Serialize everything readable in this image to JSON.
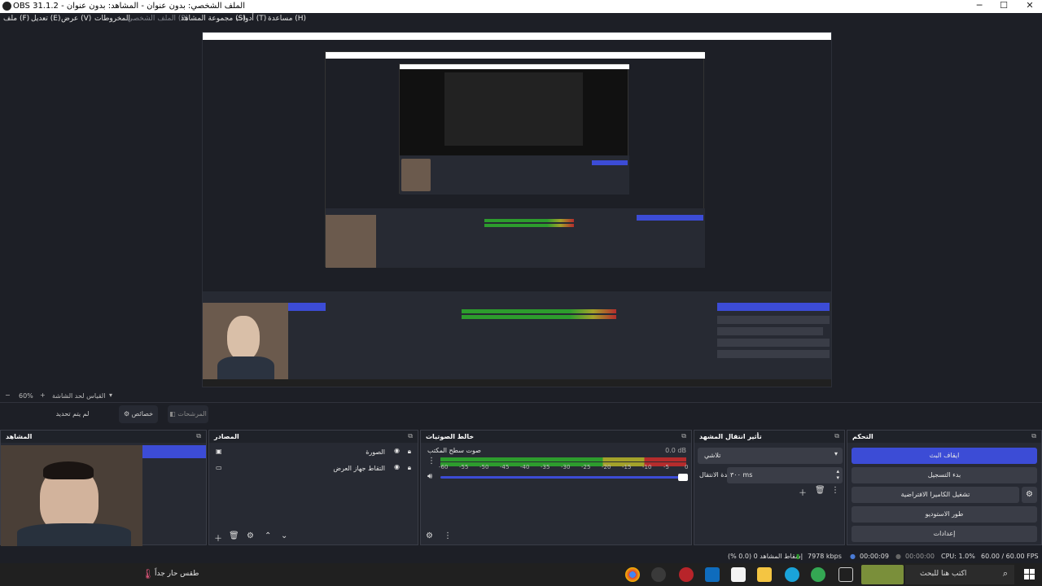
{
  "window": {
    "title": "OBS 31.1.2 - الملف الشخصي: بدون عنوان - المشاهد: بدون عنوان",
    "minimize": "─",
    "maximize": "☐",
    "close": "✕"
  },
  "menu": {
    "file": "ملف (F)",
    "edit": "تعديل (E)",
    "view": "عرض (V)",
    "docks": "المخروطات",
    "profile": "الملف الشخصي (P)",
    "scene_collection": "مجموعة المشاهد (S)",
    "tools": "أدوات (T)",
    "help": "مساعدة (H)"
  },
  "zoom": {
    "value": "60%",
    "minus": "−",
    "plus": "+",
    "fit_label": "القياس لحد الشاشة"
  },
  "toolbar": {
    "no_source": "لم يتم تحديد مصدر",
    "properties": "خصائص",
    "filters": "المرشحات"
  },
  "docks": {
    "scenes": {
      "title": "المشاهد"
    },
    "sources": {
      "title": "المصادر",
      "items": [
        {
          "label": "الصورة"
        },
        {
          "label": "التقاط جهاز العرض"
        }
      ]
    },
    "mixer": {
      "title": "خالط الصوتيات",
      "channel": "صوت سطح المكتب",
      "db": "0.0 dB",
      "ticks": [
        "-60",
        "-55",
        "-50",
        "-45",
        "-40",
        "-35",
        "-30",
        "-25",
        "-20",
        "-15",
        "-10",
        "-5",
        "0"
      ]
    },
    "transitions": {
      "title": "تأثير انتقال المشهد",
      "type": "تلاشي",
      "duration_label": "مدة الانتقال",
      "duration_value": "٣٠٠ ms"
    },
    "controls": {
      "title": "التحكم",
      "stop_stream": "ايقاف البث",
      "start_record": "بدء التسجيل",
      "virtual_cam": "تشغيل الكاميرا الافتراضية",
      "studio_mode": "طور الاستوديو",
      "settings": "إعدادات"
    }
  },
  "status": {
    "dropped": "إسقاط المشاهد 0 (0.0 %)",
    "bitrate": "7978 kbps",
    "stream_time": "00:00:09",
    "rec_time": "00:00:00",
    "cpu": "CPU: 1.0%",
    "fps": "60.00 / 60.00 FPS"
  },
  "taskbar": {
    "weather": "طقس حار جداً",
    "search_placeholder": "اكتب هنا للبحث"
  },
  "colors": {
    "accent": "#3c4cd6",
    "meter_green": "#2d9c2d",
    "meter_yellow": "#a3a22a",
    "meter_red": "#b52c2c"
  }
}
